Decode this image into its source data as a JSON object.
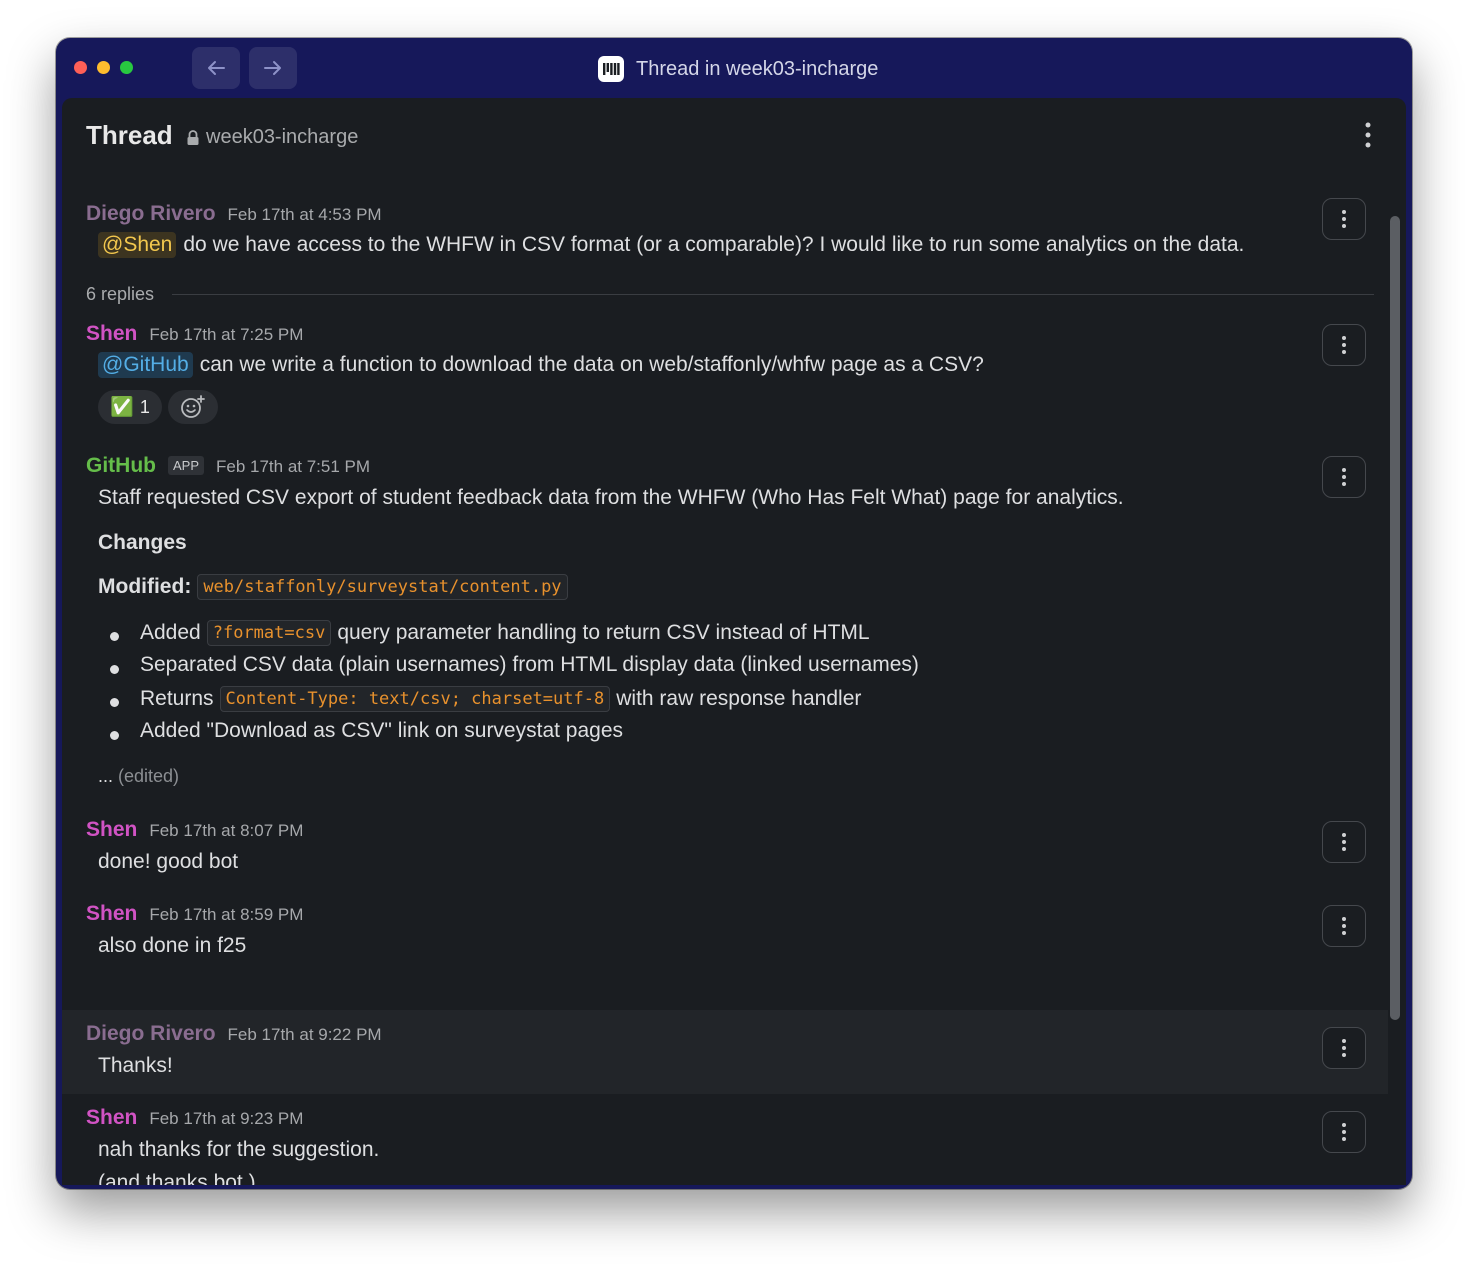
{
  "window": {
    "title": "Thread in week03-incharge"
  },
  "header": {
    "title": "Thread",
    "channel": "week03-incharge"
  },
  "parent": {
    "author": "Diego Rivero",
    "timestamp": "Feb 17th at 4:53 PM",
    "mention": "@Shen",
    "text": "do we have access to the WHFW in CSV format (or a comparable)? I would like to run some analytics on the data."
  },
  "reply_count": "6 replies",
  "messages": [
    {
      "author": "Shen",
      "timestamp": "Feb 17th at 7:25 PM",
      "mention": "@GitHub",
      "text": "can we write a function to download the data on web/staffonly/whfw page as a CSV?",
      "reaction": {
        "emoji": "✅",
        "count": "1"
      }
    },
    {
      "author": "GitHub",
      "badge": "APP",
      "timestamp": "Feb 17th at 7:51 PM",
      "summary": "Staff requested CSV export of student feedback data from the WHFW (Who Has Felt What) page for analytics.",
      "changes_heading": "Changes",
      "modified_label": "Modified:",
      "modified_file": "web/staffonly/surveystat/content.py",
      "bullets": [
        {
          "before": "Added",
          "code": "?format=csv",
          "after": "query parameter handling to return CSV instead of HTML"
        },
        {
          "before": "Separated CSV data (plain usernames) from HTML display data (linked usernames)"
        },
        {
          "before": "Returns",
          "code": "Content-Type: text/csv; charset=utf-8",
          "after": "with raw response handler"
        },
        {
          "before": "Added \"Download as CSV\" link on surveystat pages"
        }
      ],
      "ellipsis": "...",
      "edited": "(edited)"
    },
    {
      "author": "Shen",
      "timestamp": "Feb 17th at 8:07 PM",
      "text": "done! good bot"
    },
    {
      "author": "Shen",
      "timestamp": "Feb 17th at 8:59 PM",
      "text": "also done in f25"
    },
    {
      "author": "Diego Rivero",
      "timestamp": "Feb 17th at 9:22 PM",
      "text": "Thanks!"
    },
    {
      "author": "Shen",
      "timestamp": "Feb 17th at 9:23 PM",
      "lines": [
        "nah thanks for the suggestion.",
        "(and thanks bot.)"
      ]
    }
  ],
  "colors": {
    "window_frame": "#16185a",
    "panel_bg": "#1a1d21",
    "author_diego": "#8a6d90",
    "author_shen": "#d153c4",
    "author_github": "#65bd4a",
    "code_text": "#e8912d",
    "mention_user": "#f2c74e",
    "mention_app": "#54aee6"
  },
  "icons": [
    "back-arrow-icon",
    "forward-arrow-icon",
    "app-logo-icon",
    "lock-icon",
    "kebab-menu-icon",
    "add-reaction-icon"
  ]
}
